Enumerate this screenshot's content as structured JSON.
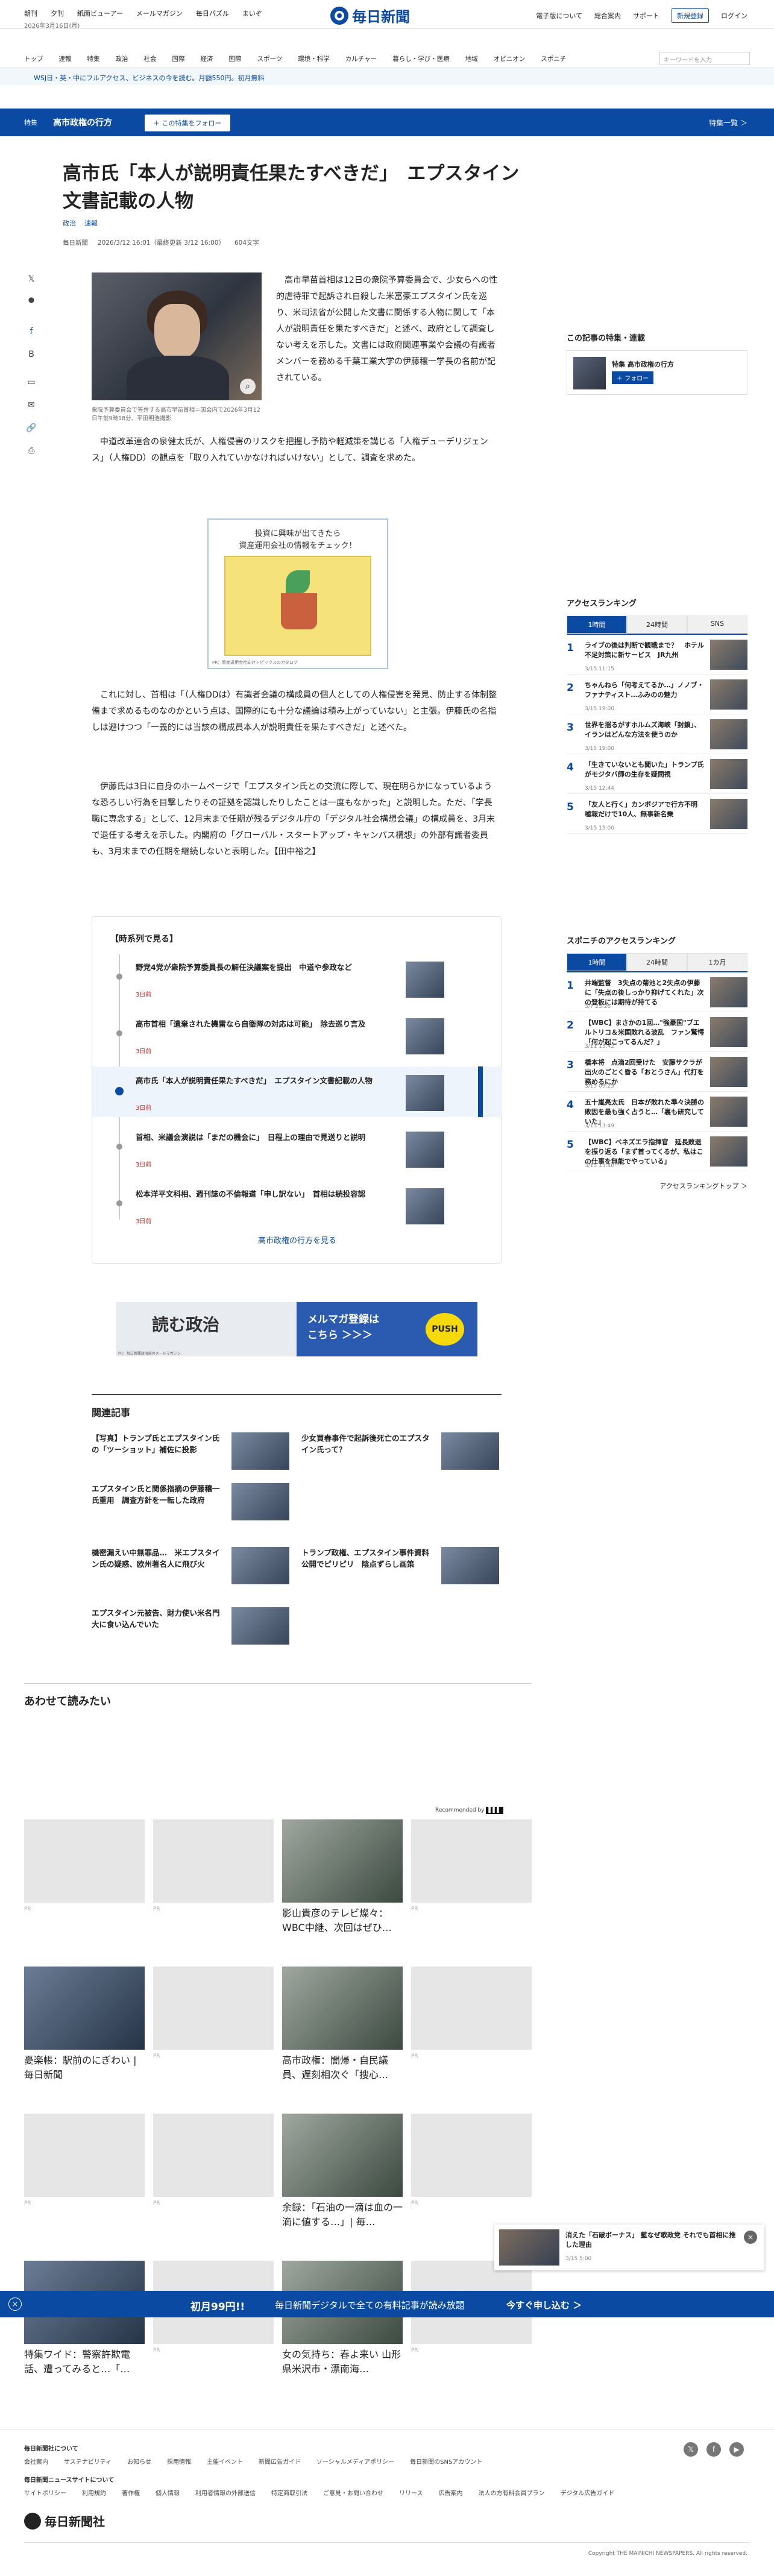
{
  "topbar": {
    "links": [
      "朝刊",
      "夕刊",
      "紙面ビューアー",
      "メールマガジン",
      "毎日パズル",
      "まいぞ"
    ],
    "date": "2026年3月16日(月)",
    "logo": "毎日新聞",
    "right": [
      "電子版について",
      "総合案内",
      "サポート"
    ],
    "register": "新規登録",
    "login": "ログイン"
  },
  "nav": {
    "items": [
      "トップ",
      "速報",
      "特集",
      "政治",
      "社会",
      "国際",
      "経済",
      "国際",
      "スポーツ",
      "環境・科学",
      "カルチャー",
      "暮らし・学び・医療",
      "地域",
      "オピニオン",
      "スポニチ"
    ],
    "search_placeholder": "キーワードを入力"
  },
  "promo": {
    "text": "WSJ日・英・中にフルアクセス、ビジネスの今を読む。月額550円。初月無料"
  },
  "band": {
    "label": "特集",
    "title": "高市政権の行方",
    "follow": "＋ この特集をフォロー",
    "list": "特集一覧 ＞"
  },
  "article": {
    "title": "高市氏「本人が説明責任果たすべきだ」　エプスタイン文書記載の人物",
    "tags": [
      "政治",
      "速報"
    ],
    "meta": [
      "毎日新聞",
      "2026/3/12 16:01（最終更新 3/12 16:00）",
      "604文字"
    ],
    "caption": "衆院予算委員会で答弁する高市早苗首相＝国会内で2026年3月12日午前9時18分、平田明浩撮影",
    "p1": "高市早苗首相は12日の衆院予算委員会で、少女らへの性的虐待罪で起訴され自殺した米富豪エプスタイン氏を巡り、米司法省が公開した文書に関係する人物に関して「本人が説明責任を果たすべきだ」と述べ、政府として調査しない考えを示した。文書には政府関連事業や会議の有識者メンバーを務める千葉工業大学の伊藤穰一学長の名前が記されている。",
    "p2": "中道改革連合の泉健太氏が、人権侵害のリスクを把握し予防や軽減策を講じる「人権デューデリジェンス」（人権DD）の観点を「取り入れていかなければいけない」として、調査を求めた。",
    "p3": "これに対し、首相は「（人権DDは）有識者会議の構成員の個人としての人権侵害を発見、防止する体制整備まで求めるものなのかという点は、国際的にも十分な議論は積み上がっていない」と主張。伊藤氏の名指しは避けつつ「一義的には当該の構成員本人が説明責任を果たすべきだ」と述べた。",
    "p4": "伊藤氏は3日に自身のホームページで「エプスタイン氏との交流に際して、現在明らかになっているような恐ろしい行為を目撃したりその証拠を認識したりしたことは一度もなかった」と説明した。ただ、「学長職に専念する」として、12月末まで任期が残るデジタル庁の「デジタル社会構想会議」の構成員を、3月末で退任する考えを示した。内閣府の「グローバル・スタートアップ・キャンパス構想」の外部有識者委員も、3月末までの任期を継続しないと表明した。【田中裕之】"
  },
  "ad1": {
    "text": "投資に興味が出てきたら\n資産運用会社の情報をチェック！",
    "foot": "PR：資産運用会社向けトピックスのカタログ"
  },
  "series": {
    "title": "【時系列で見る】",
    "items": [
      {
        "t": "野党4党が衆院予算委員長の解任決議案を提出　中道や参政など",
        "d": "3日前"
      },
      {
        "t": "高市首相「遺棄された機雷なら自衛隊の対応は可能」　除去巡り言及",
        "d": "3日前"
      },
      {
        "t": "高市氏「本人が説明責任果たすべきだ」　エプスタイン文書記載の人物",
        "d": "3日前"
      },
      {
        "t": "首相、米議会演説は「まだの機会に」　日程上の理由で見送りと説明",
        "d": "3日前"
      },
      {
        "t": "松本洋平文科相、週刊誌の不倫報道「申し訳ない」　首相は続投容認",
        "d": "3日前"
      }
    ],
    "more": "高市政権の行方を見る"
  },
  "banner2": {
    "left": "読む政治",
    "right": "メルマガ登録は\nこちら ＞＞＞",
    "push": "PUSH",
    "foot": "PR：毎日新聞政治部のメールマガジン"
  },
  "related": {
    "title": "関連記事",
    "items": [
      "【写真】トランプ氏とエプスタイン氏の「ツーショット」補佐に投影",
      "少女買春事件で起訴後死亡のエプスタイン氏って？",
      "エプスタイン氏と関係指摘の伊藤穰一氏重用　調査方針を一転した政府",
      "",
      "機密漏えい中無罪品…　米エプスタイン氏の疑惑、欧州著名人に飛び火",
      "トランプ政権、エプスタイン事件資料公開でピリピリ　陰点ずらし画策",
      "エプスタイン元被告、財力使い米名門大に食い込んでいた"
    ]
  },
  "sidebar": {
    "feature_title": "この記事の特集・連載",
    "feature_item": "特集 高市政権の行方",
    "feature_follow": "＋ フォロー",
    "ranking_title": "アクセスランキング",
    "tabs": [
      "1時間",
      "24時間",
      "SNS"
    ],
    "ranks": [
      {
        "n": "1",
        "t": "ライブの後は判断で観戦まで？　ホテル不足対策に新サービス　JR九州",
        "d": "3/15 11:15"
      },
      {
        "n": "2",
        "t": "ちゃんねら「何考えてるか…」ノノブ・ファナティスト…ふみのの魅力",
        "d": "3/15 19:00"
      },
      {
        "n": "3",
        "t": "世界を揺るがすホルムズ海峡「封鎖」、イランはどんな方法を使うのか",
        "d": "3/15 19:00"
      },
      {
        "n": "4",
        "t": "「生きていないとも聞いた」トランプ氏がモジタバ師の生存を疑問視",
        "d": "3/15 12:44"
      },
      {
        "n": "5",
        "t": "「友人と行く」カンボジアで行方不明　嘘報だけで10人、無事新名乗",
        "d": "3/15 15:00"
      }
    ],
    "sponichi_title": "スポニチのアクセスランキング",
    "sponichi_tabs": [
      "1時間",
      "24時間",
      "1カ月"
    ],
    "sranks": [
      {
        "n": "1",
        "t": "井端監督　3失点の菊池と2失点の伊藤に「失点の後しっかり抑げてくれた」次の登板には期待が持てる",
        "d": "3/7 23:26"
      },
      {
        "n": "2",
        "t": "【WBC】まさかの1回…\"強豪国\"ブエルトリコ＆米国敗れる波乱　ファン驚愕「何が起こってるんだ？」",
        "d": "3/11 13:42"
      },
      {
        "n": "3",
        "t": "橋本将　点滴2回受けた　安藤サクラが出火のごとく昏る「おとうさん」代打を務めるにか",
        "d": "3/15 09:25"
      },
      {
        "n": "4",
        "t": "五十嵐亮太氏　日本が敗れた準々決勝の敗因を最も強く占うと…「裏も研究していた」",
        "d": "3/15 13:49"
      },
      {
        "n": "5",
        "t": "【WBC】ベネズエラ指揮官　延長敗退を振り返る「まず首ってくるが、私はこの仕事を無能でやっている」",
        "d": "3/15 15:40"
      }
    ],
    "more": "アクセスランキングトップ ＞"
  },
  "recommend": {
    "title": "あわせて読みたい",
    "by": "Recommended by",
    "cards": [
      {
        "pr": "PR",
        "t": ""
      },
      {
        "pr": "PR",
        "t": ""
      },
      {
        "pr": "",
        "t": "影山貴彦のテレビ燦々：WBC中継、次回はぜひ…"
      },
      {
        "pr": "PR",
        "t": ""
      },
      {
        "pr": "",
        "t": "憂楽帳：駅前のにぎわい | 毎日新聞"
      },
      {
        "pr": "PR",
        "t": ""
      },
      {
        "pr": "",
        "t": "高市政権：闇帰・自民議員、遅刻相次ぐ「搜心…"
      },
      {
        "pr": "PR",
        "t": ""
      },
      {
        "pr": "PR",
        "t": ""
      },
      {
        "pr": "PR",
        "t": ""
      },
      {
        "pr": "",
        "t": "余録：「石油の一滴は血の一滴に値する…」| 毎…"
      },
      {
        "pr": "PR",
        "t": ""
      },
      {
        "pr": "",
        "t": "特集ワイド：警察許欺電話、遭ってみると…「…"
      },
      {
        "pr": "PR",
        "t": ""
      },
      {
        "pr": "",
        "t": "女の気持ち：春よ来い 山形県米沢市・漂南海…"
      },
      {
        "pr": "PR",
        "t": ""
      }
    ]
  },
  "popup": {
    "t": "消えた「石破ボーナス」 藍なぜ歌政党 それでも首相に推した理由",
    "d": "3/15 5:00"
  },
  "bottom": {
    "a": "初月99円!!",
    "b": "毎日新聞デジタルで全ての有料記事が読み放題",
    "c": "今すぐ申し込む ＞"
  },
  "footer": {
    "about": "毎日新聞社について",
    "links1": [
      "会社案内",
      "サステナビリティ",
      "お知らせ",
      "採用情報",
      "主催イベント",
      "新聞広告ガイド",
      "ソーシャルメディアポリシー",
      "毎日新聞のSNSアカウント"
    ],
    "site": "毎日新聞ニュースサイトについて",
    "links2": [
      "サイトポリシー",
      "利用規約",
      "著作権",
      "個人情報",
      "利用者情報の外部送信",
      "特定商取引法",
      "ご意見・お問い合わせ",
      "リリース",
      "広告案内",
      "法人の方有料会員プラン",
      "デジタル広告ガイド"
    ],
    "name": "毎日新聞社",
    "copyright": "Copyright THE MAINICHI NEWSPAPERS. All rights reserved."
  }
}
